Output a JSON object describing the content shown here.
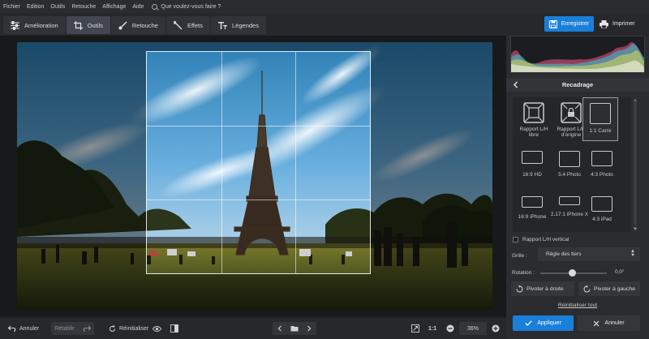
{
  "menu": {
    "items": [
      "Fichier",
      "Edition",
      "Outils",
      "Retouche",
      "Affichage",
      "Aide"
    ],
    "search_placeholder": "Que voulez-vous faire ?"
  },
  "tabs": [
    {
      "label": "Amélioration",
      "icon": "sliders-icon"
    },
    {
      "label": "Outils",
      "icon": "crop-icon",
      "active": true
    },
    {
      "label": "Retouche",
      "icon": "brush-icon"
    },
    {
      "label": "Effets",
      "icon": "magic-wand-icon"
    },
    {
      "label": "Légendes",
      "icon": "text-icon"
    }
  ],
  "header_actions": {
    "save_label": "Enregistrer",
    "print_label": "Imprimer"
  },
  "bottom": {
    "undo_label": "Annuler",
    "redo_label": "Rétablir",
    "reset_label": "Réinitialiser",
    "zoom_label": "1:1",
    "zoom_value": "36%"
  },
  "panel": {
    "title": "Recadrage",
    "presets": [
      {
        "label": "Rapport L/H libre",
        "icon": "free-ratio-icon"
      },
      {
        "label": "Rapport L/H d'origine",
        "icon": "original-ratio-lock-icon"
      },
      {
        "label": "1:1 Carré",
        "selected": true
      },
      {
        "label": "16:9 HD"
      },
      {
        "label": "5:4 Photo"
      },
      {
        "label": "4:3 Photo"
      },
      {
        "label": "16:9 iPhone"
      },
      {
        "label": "2.17:1 iPhone X"
      },
      {
        "label": "4:3 iPad"
      }
    ],
    "vertical_ratio_label": "Rapport L/H vertical",
    "grid_label": "Grille :",
    "grid_value": "Règle des tiers",
    "rotation_label": "Rotation :",
    "rotation_value": "0,0°",
    "rotate_right_label": "Pivoter à droite",
    "rotate_left_label": "Pivoter à gauche",
    "reset_all_label": "Réinitialiser tout",
    "apply_label": "Appliquer",
    "cancel_label": "Annuler"
  },
  "colors": {
    "accent": "#1a7fd8",
    "panel_bg": "#2a2c30",
    "toolbar_bg": "#26282c"
  }
}
